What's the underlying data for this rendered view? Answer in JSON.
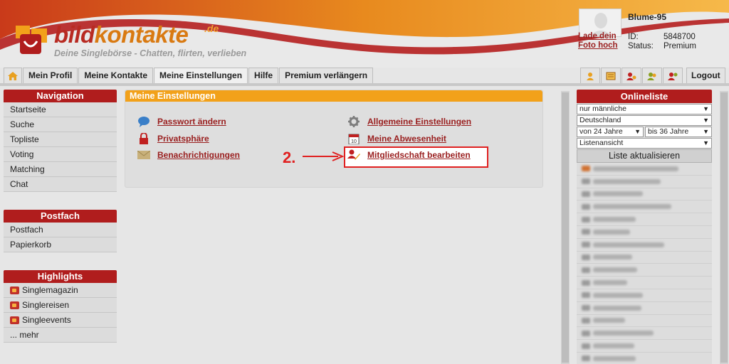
{
  "brand": {
    "logo_text_part1": "bild",
    "logo_text_part2": "kontakte",
    "logo_suffix": ".de",
    "tagline": "Deine Singlebörse - Chatten, flirten, verlieben",
    "colors": {
      "red": "#b01d1d",
      "orange": "#f2a11a"
    }
  },
  "user": {
    "name": "Blume-95",
    "upload_link": "Lade dein Foto hoch",
    "id_label": "ID:",
    "id_value": "5848700",
    "status_label": "Status:",
    "status_value": "Premium"
  },
  "tabs": [
    {
      "label": "Mein Profil"
    },
    {
      "label": "Meine Kontakte"
    },
    {
      "label": "Meine Einstellungen",
      "active": true
    },
    {
      "label": "Hilfe"
    },
    {
      "label": "Premium verlängern"
    }
  ],
  "logout_label": "Logout",
  "navigation": {
    "title": "Navigation",
    "items": [
      "Startseite",
      "Suche",
      "Topliste",
      "Voting",
      "Matching",
      "Chat"
    ]
  },
  "postfach": {
    "title": "Postfach",
    "items": [
      "Postfach",
      "Papierkorb"
    ]
  },
  "highlights": {
    "title": "Highlights",
    "items": [
      "Singlemagazin",
      "Singlereisen",
      "Singleevents",
      "... mehr"
    ]
  },
  "settings": {
    "title": "Meine Einstellungen",
    "left_links": [
      "Passwort ändern",
      "Privatsphäre",
      "Benachrichtigungen"
    ],
    "right_links": [
      "Allgemeine Einstellungen",
      "Meine Abwesenheit",
      "Mitgliedschaft bearbeiten"
    ]
  },
  "annotation": {
    "step": "2."
  },
  "online": {
    "title": "Onlineliste",
    "filter_gender": "nur männliche",
    "filter_country": "Deutschland",
    "filter_age_from": "von 24 Jahre",
    "filter_age_to": "bis 36 Jahre",
    "filter_view": "Listenansicht",
    "refresh_label": "Liste aktualisieren"
  }
}
